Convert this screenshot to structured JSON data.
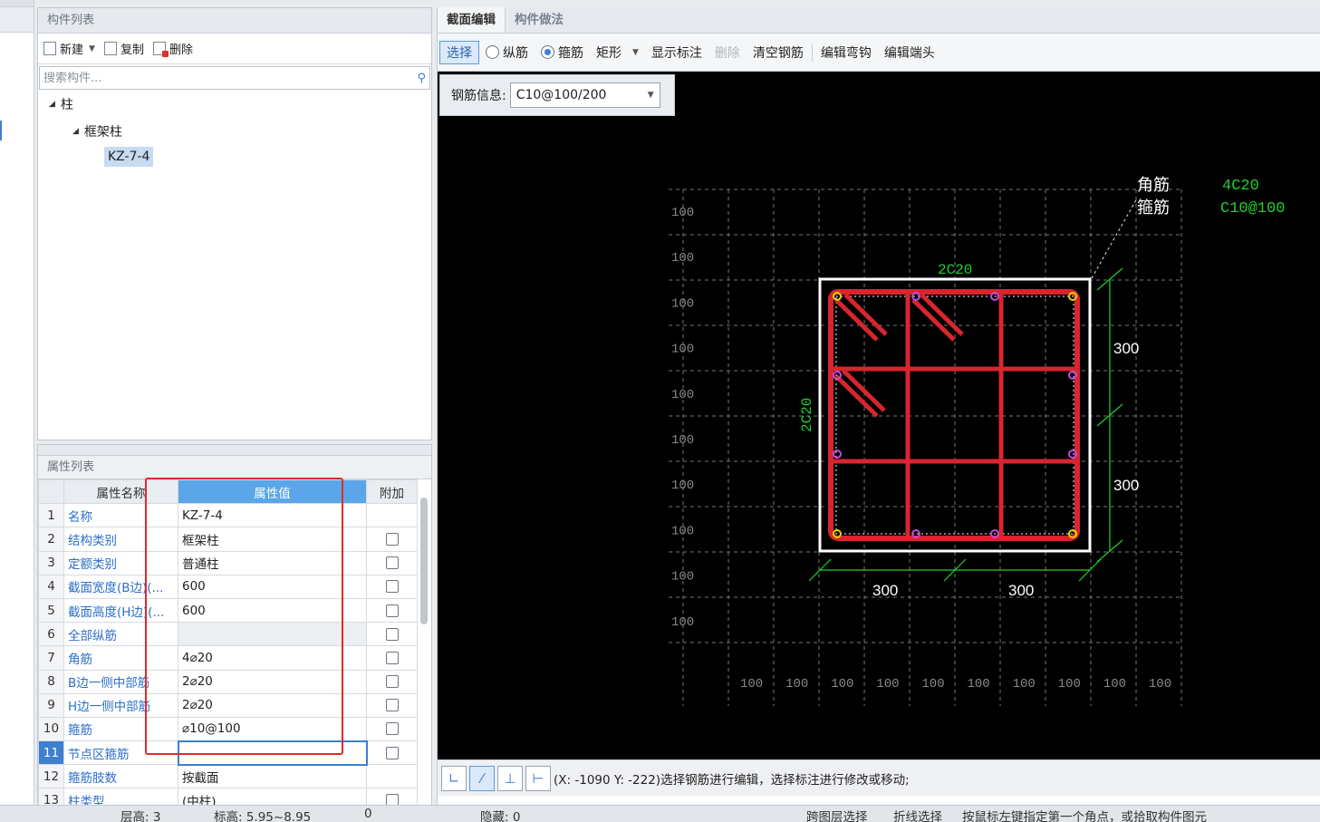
{
  "component_list": {
    "title": "构件列表",
    "toolbar": {
      "new_label": "新建",
      "copy_label": "复制",
      "delete_label": "删除"
    },
    "search_placeholder": "搜索构件...",
    "tree": {
      "root": "柱",
      "child": "框架柱",
      "leaf": "KZ-7-4"
    }
  },
  "property_list": {
    "title": "属性列表",
    "headers": {
      "name": "属性名称",
      "value": "属性值",
      "extra": "附加"
    },
    "rows": [
      {
        "num": "1",
        "name": "名称",
        "value": "KZ-7-4",
        "checkbox": false
      },
      {
        "num": "2",
        "name": "结构类别",
        "value": "框架柱",
        "checkbox": true
      },
      {
        "num": "3",
        "name": "定额类别",
        "value": "普通柱",
        "checkbox": true
      },
      {
        "num": "4",
        "name": "截面宽度(B边)(...",
        "value": "600",
        "checkbox": true
      },
      {
        "num": "5",
        "name": "截面高度(H边)(...",
        "value": "600",
        "checkbox": true
      },
      {
        "num": "6",
        "name": "全部纵筋",
        "value": "",
        "checkbox": true
      },
      {
        "num": "7",
        "name": "角筋",
        "value": "4⌀20",
        "checkbox": true
      },
      {
        "num": "8",
        "name": "B边一侧中部筋",
        "value": "2⌀20",
        "checkbox": true
      },
      {
        "num": "9",
        "name": "H边一侧中部筋",
        "value": "2⌀20",
        "checkbox": true
      },
      {
        "num": "10",
        "name": "箍筋",
        "value": "⌀10@100",
        "checkbox": true
      },
      {
        "num": "11",
        "name": "节点区箍筋",
        "value": "",
        "checkbox": true
      },
      {
        "num": "12",
        "name": "箍筋肢数",
        "value": "按截面",
        "checkbox": false
      },
      {
        "num": "13",
        "name": "柱类型",
        "value": "(中柱)",
        "checkbox": true
      }
    ]
  },
  "editor": {
    "tabs": [
      "截面编辑",
      "构件做法"
    ],
    "toolbar": {
      "select": "选择",
      "longitudinal": "纵筋",
      "stirrup": "箍筋",
      "shape": "矩形",
      "show_dims": "显示标注",
      "delete": "删除",
      "clear": "清空钢筋",
      "edit_hook": "编辑弯钩",
      "edit_end": "编辑端头"
    },
    "rebar_info_label": "钢筋信息:",
    "rebar_info_value": "C10@100/200",
    "canvas": {
      "legend_corner": "角筋",
      "legend_stirrup": "箍筋",
      "legend_corner_value": "4C20",
      "legend_stirrup_value": "C10@100",
      "top_label": "2C20",
      "side_label": "2C20",
      "dim_right": [
        "300",
        "300"
      ],
      "dim_bottom": [
        "300",
        "300"
      ],
      "grid_label": "100"
    },
    "status_text": "(X: -1090 Y: -222)选择钢筋进行编辑，选择标注进行修改或移动;"
  },
  "bottom_bar": {
    "floor": "层高:  3",
    "elevation": "标高:  5.95~8.95",
    "zero": "0",
    "hidden": "隐藏: 0",
    "cross_layer": "跨图层选择",
    "polyline": "折线选择",
    "hint": "按鼠标左键指定第一个角点，或拾取构件图元"
  },
  "colors": {
    "rebar": "#d8252e",
    "dimension": "#1fd12b",
    "highlight_box": "#e12a2a",
    "accent": "#3d7fd0"
  }
}
